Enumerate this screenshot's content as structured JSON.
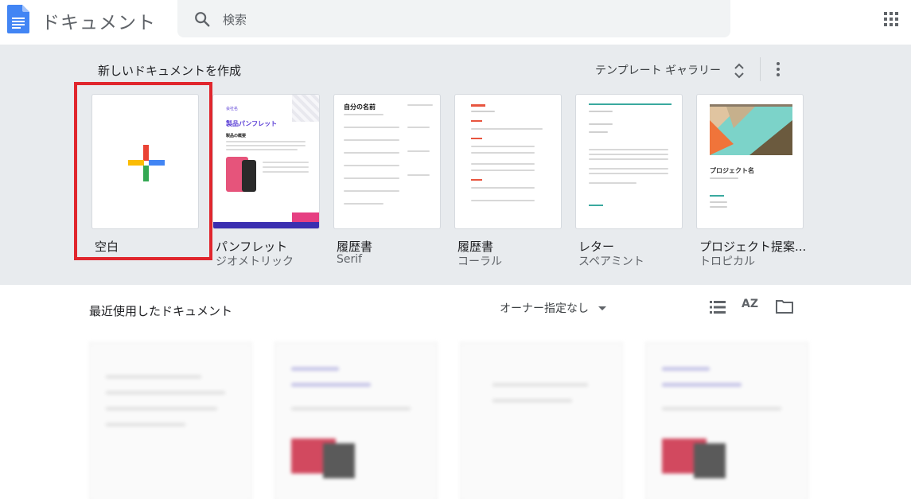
{
  "header": {
    "app_title": "ドキュメント",
    "search_placeholder": "検索"
  },
  "templates": {
    "section_title": "新しいドキュメントを作成",
    "gallery_label": "テンプレート ギャラリー",
    "items": [
      {
        "name": "空白",
        "sub": ""
      },
      {
        "name": "パンフレット",
        "sub": "ジオメトリック"
      },
      {
        "name": "履歴書",
        "sub": "Serif"
      },
      {
        "name": "履歴書",
        "sub": "コーラル"
      },
      {
        "name": "レター",
        "sub": "スペアミント"
      },
      {
        "name": "プロジェクト提案...",
        "sub": "トロピカル"
      }
    ],
    "thumbs": {
      "brochure_title": "製品パンフレット",
      "brochure_heading": "製品の概要",
      "brochure_company": "会社名",
      "resume_serif_name": "自分の名前",
      "project_title": "プロジェクト名"
    }
  },
  "recent": {
    "title": "最近使用したドキュメント",
    "owner_filter": "オーナー指定なし",
    "sort_label": "AZ"
  },
  "colors": {
    "accent_blue": "#4285f4",
    "highlight_red": "#e0262d",
    "strip_bg": "#e8ebee"
  }
}
